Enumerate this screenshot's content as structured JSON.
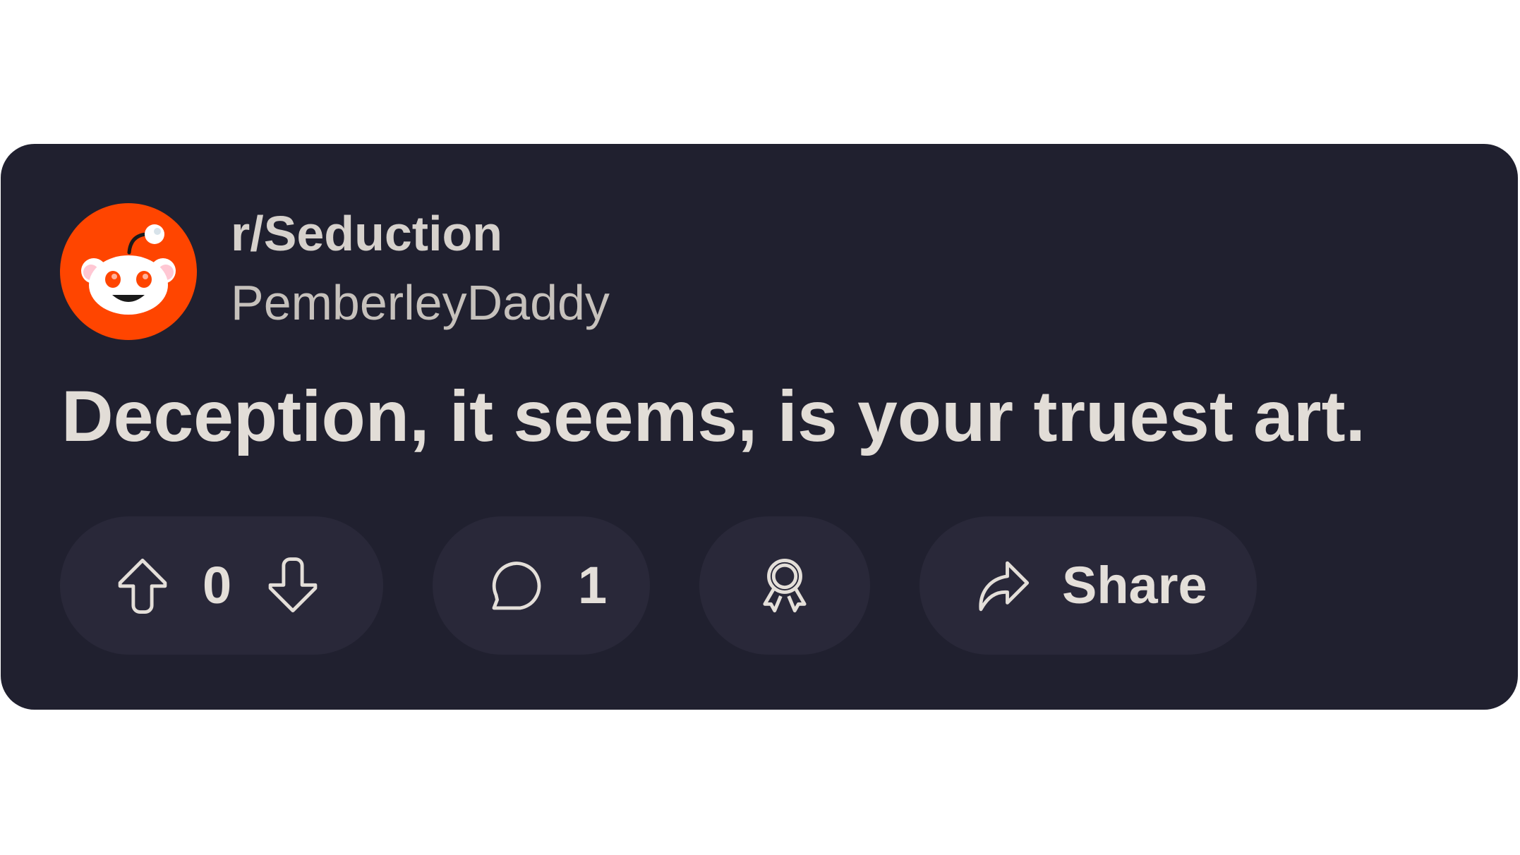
{
  "post": {
    "subreddit": "r/Seduction",
    "username": "PemberleyDaddy",
    "title": "Deception, it seems, is your truest art."
  },
  "actions": {
    "vote_count": "0",
    "comment_count": "1",
    "share_label": "Share"
  },
  "icons": {
    "avatar": "reddit-snoo-icon",
    "upvote": "arrow-up-icon",
    "downvote": "arrow-down-icon",
    "comment": "speech-bubble-icon",
    "award": "award-ribbon-icon",
    "share": "share-arrow-icon"
  },
  "colors": {
    "card_background": "#20202f",
    "pill_background": "#292839",
    "text": "#e2ddd7",
    "reddit_orange": "#ff4500"
  }
}
